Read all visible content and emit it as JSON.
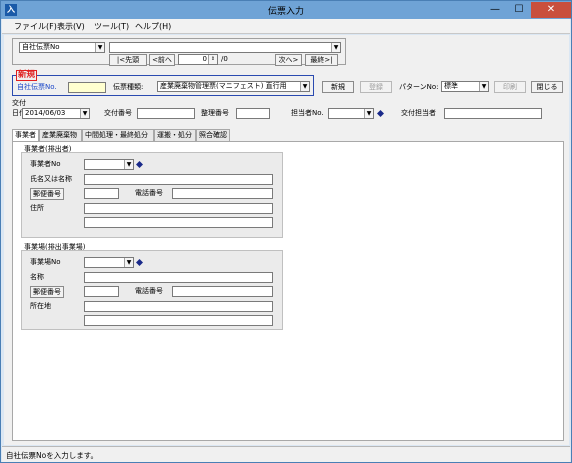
{
  "window": {
    "title": "伝票入力",
    "minimize": "—",
    "maximize": "☐",
    "close": "✕",
    "app_icon_letter": "入"
  },
  "menu": [
    {
      "label": "ファイル(F)"
    },
    {
      "label": "表示(V)"
    },
    {
      "label": "ツール(T)"
    },
    {
      "label": "ヘルプ(H)"
    }
  ],
  "nav": {
    "search_type": "自社伝票No",
    "search_value": "",
    "first_label": "|<先頭",
    "prev_label": "<前へ",
    "current_page": "0",
    "total_label": "/0",
    "next_label": "次へ>",
    "last_label": "最終>|"
  },
  "mode_badge": "新規",
  "slip": {
    "own_no_label": "自社伝票No.",
    "own_no_value": "",
    "type_label": "伝票種類:",
    "type_value": "産業廃棄物管理票(マニフェスト) 直行用",
    "new_label": "新規",
    "register_label": "登録",
    "pattern_label": "パターンNo:",
    "pattern_value": "標準",
    "print_label": "印刷",
    "close_label": "閉じる"
  },
  "issue": {
    "section_label": "交付",
    "date_label": "日付",
    "date_value": "2014/06/03",
    "issue_no_label": "交付番号",
    "issue_no_value": "",
    "sort_no_label": "整理番号",
    "sort_no_value": "",
    "staff_no_label": "担当者No.",
    "staff_no_value": "",
    "issuer_label": "交付担当者",
    "issuer_value": ""
  },
  "tabs": [
    {
      "label": "事業者",
      "active": true
    },
    {
      "label": "産業廃棄物",
      "active": false
    },
    {
      "label": "中間処理・最終処分",
      "active": false
    },
    {
      "label": "運搬・処分",
      "active": false
    },
    {
      "label": "照合確認",
      "active": false
    }
  ],
  "discharger": {
    "section_label": "事業者(排出者)",
    "no_label": "事業者No",
    "name_label": "氏名又は名称",
    "zip_button": "郵便番号",
    "phone_label": "電話番号",
    "address_label": "住所"
  },
  "site": {
    "section_label": "事業場(排出事業場)",
    "no_label": "事業場No",
    "name_label": "名称",
    "zip_button": "郵便番号",
    "phone_label": "電話番号",
    "address_label": "所在地"
  },
  "status": {
    "message": "自社伝票Noを入力します。"
  },
  "colors": {
    "accent_blue": "#1a46c8",
    "badge_red": "#e02020",
    "title_bar": "#6fa3d6"
  }
}
